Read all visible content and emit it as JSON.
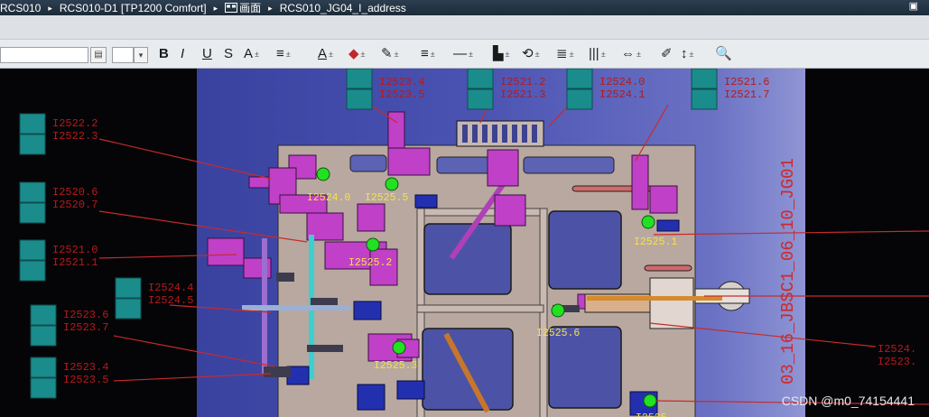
{
  "breadcrumb": {
    "items": [
      "RCS010",
      "RCS010-D1 [TP1200 Comfort]",
      "画面",
      "RCS010_JG04_I_address"
    ],
    "separator": "▸"
  },
  "toolbar": {
    "buttons": [
      {
        "name": "bold-button",
        "label": "B"
      },
      {
        "name": "italic-button",
        "label": "I"
      },
      {
        "name": "underline-button",
        "label": "U"
      },
      {
        "name": "strikethrough-button",
        "label": "S"
      },
      {
        "name": "font-size-button",
        "label": "A"
      },
      {
        "name": "align-button",
        "label": "≡"
      },
      {
        "name": "font-color-button",
        "label": "A"
      },
      {
        "name": "fill-color-button",
        "label": "◆"
      },
      {
        "name": "line-color-button",
        "label": "✎"
      },
      {
        "name": "line-width-button",
        "label": "≡"
      },
      {
        "name": "line-style-button",
        "label": "—"
      },
      {
        "name": "align-objects-button",
        "label": "▙"
      },
      {
        "name": "rotate-button",
        "label": "⟲"
      },
      {
        "name": "layer-button",
        "label": "≣"
      },
      {
        "name": "distribute-button",
        "label": "|||"
      },
      {
        "name": "spacing-button",
        "label": "⇔"
      },
      {
        "name": "format-painter-button",
        "label": "✐"
      },
      {
        "name": "order-button",
        "label": "↕"
      },
      {
        "name": "zoom-button",
        "label": "🔍"
      }
    ]
  },
  "canvas": {
    "colors": {
      "background": "#050508",
      "screen": "#4a52b2",
      "tag_text": "#b51a1a",
      "io_box": "#1a8c8c",
      "fixture": "#c040c8",
      "sensor": "#22e022",
      "drop_label": "#f4e04a"
    },
    "tag_groups": [
      {
        "id": "tl-1",
        "lines": [
          "I2522.2",
          "I2522.3"
        ]
      },
      {
        "id": "tl-2",
        "lines": [
          "I2520.6",
          "I2520.7"
        ]
      },
      {
        "id": "tl-3",
        "lines": [
          "I2521.0",
          "I2521.1"
        ]
      },
      {
        "id": "tl-4",
        "lines": [
          "I2524.4",
          "I2524.5"
        ]
      },
      {
        "id": "tl-5",
        "lines": [
          "I2523.6",
          "I2523.7"
        ]
      },
      {
        "id": "tl-6",
        "lines": [
          "I2523.4",
          "I2523.5"
        ]
      },
      {
        "id": "tp-1",
        "lines": [
          "I2523.4",
          "I2523.5"
        ]
      },
      {
        "id": "tp-2",
        "lines": [
          "I2521.2",
          "I2521.3"
        ]
      },
      {
        "id": "tp-3",
        "lines": [
          "I2524.0",
          "I2524.1"
        ]
      },
      {
        "id": "tp-4",
        "lines": [
          "I2521.6",
          "I2521.7"
        ]
      },
      {
        "id": "rt-1",
        "lines": [
          "I2524.",
          "I2523."
        ]
      }
    ],
    "drop_labels": [
      "I2524.0",
      "I2525.5",
      "I2525.2",
      "I2525.1",
      "I2525.6",
      "I2525.3",
      "I2525"
    ],
    "rotated_label": "03_16_JBSC1_06_10_JG01"
  },
  "watermark": "CSDN @m0_74154441"
}
